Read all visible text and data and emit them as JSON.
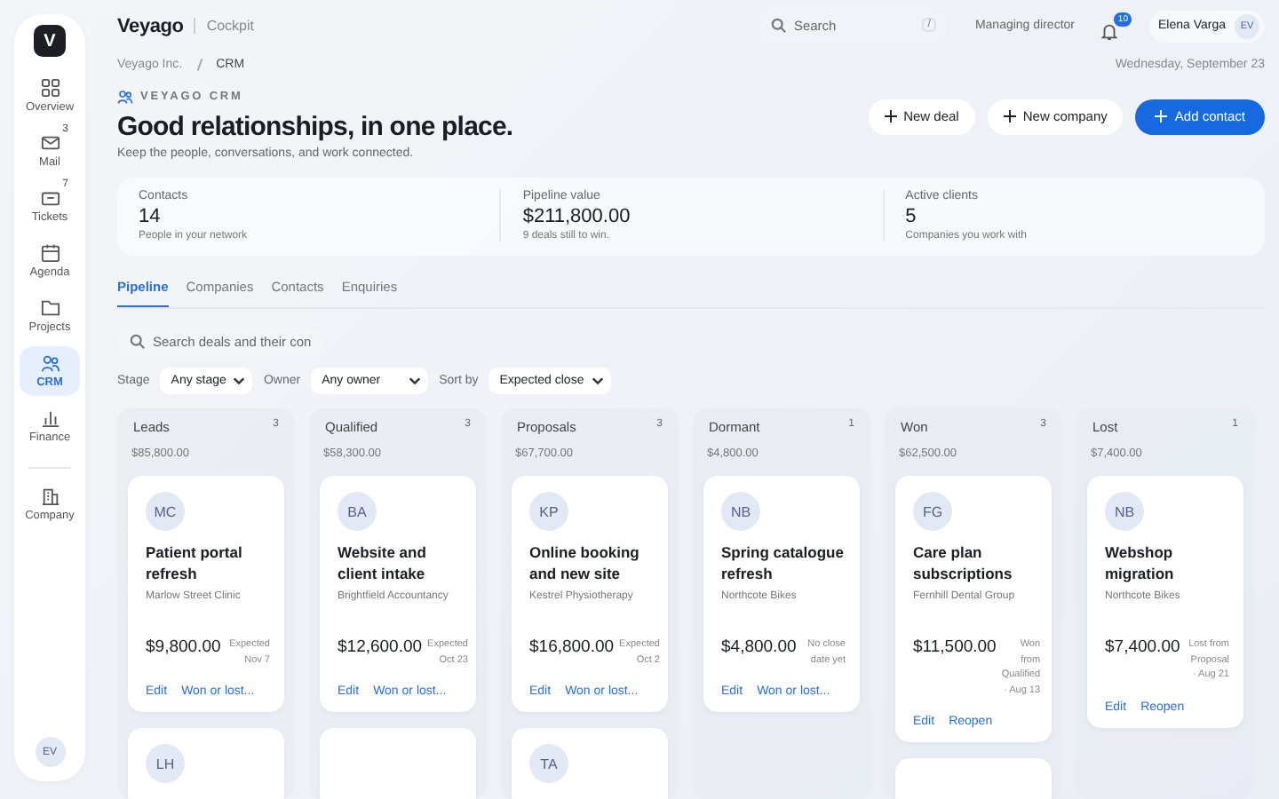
{
  "sidebar": {
    "logo": "V",
    "items": [
      {
        "label": "Overview",
        "selected": false
      },
      {
        "label": "Mail",
        "badge": "3",
        "selected": false
      },
      {
        "label": "Tickets",
        "badge": "7",
        "selected": false
      },
      {
        "label": "Agenda",
        "selected": false
      },
      {
        "label": "Projects",
        "selected": false
      },
      {
        "label": "CRM",
        "selected": true
      },
      {
        "label": "Finance",
        "selected": false
      },
      {
        "label": "Company",
        "selected": false,
        "divider_before": true
      }
    ],
    "user_initials": "EV"
  },
  "topbar": {
    "brand": "Veyago",
    "section": "Cockpit",
    "search_placeholder": "Search",
    "search_shortcut": "/",
    "role": "Managing director",
    "notifications": "10",
    "user_name": "Elena Varga",
    "user_initials": "EV"
  },
  "breadcrumb": [
    "Veyago Inc.",
    "CRM"
  ],
  "date": "Wednesday, September 23",
  "header": {
    "eyebrow": "VEYAGO CRM",
    "title": "Good relationships, in one place.",
    "subtitle": "Keep the people, conversations, and work connected.",
    "buttons": [
      {
        "label": "New deal",
        "kind": "secondary"
      },
      {
        "label": "New company",
        "kind": "secondary"
      },
      {
        "label": "Add contact",
        "kind": "primary"
      }
    ]
  },
  "stats": [
    {
      "label": "Contacts",
      "value": "14",
      "note": "People in your network"
    },
    {
      "label": "Pipeline value",
      "value": "$211,800.00",
      "note": "9 deals still to win."
    },
    {
      "label": "Active clients",
      "value": "5",
      "note": "Companies you work with"
    }
  ],
  "tabs": [
    {
      "label": "Pipeline",
      "selected": true
    },
    {
      "label": "Companies",
      "selected": false
    },
    {
      "label": "Contacts",
      "selected": false
    },
    {
      "label": "Enquiries",
      "selected": false
    }
  ],
  "filters": {
    "search_placeholder": "Search deals and their con",
    "selects": [
      {
        "label": "Stage",
        "value": "Any stage"
      },
      {
        "label": "Owner",
        "value": "Any owner"
      },
      {
        "label": "Sort by",
        "value": "Expected close"
      }
    ]
  },
  "columns": [
    {
      "name": "Leads",
      "count": "3",
      "total": "$85,800.00",
      "cards": [
        {
          "kind": "deal",
          "initials": "MC",
          "title": "Patient portal refresh",
          "company": "Marlow Street Clinic",
          "amount": "$9,800.00",
          "note": "Expected Nov 7",
          "actions": [
            "Edit",
            "Won or lost..."
          ]
        },
        {
          "kind": "peek",
          "initials": "LH"
        }
      ]
    },
    {
      "name": "Qualified",
      "count": "3",
      "total": "$58,300.00",
      "cards": [
        {
          "kind": "deal",
          "initials": "BA",
          "title": "Website and client intake",
          "company": "Brightfield Accountancy",
          "amount": "$12,600.00",
          "note": "Expected Oct 23",
          "actions": [
            "Edit",
            "Won or lost..."
          ]
        },
        {
          "kind": "peek"
        }
      ]
    },
    {
      "name": "Proposals",
      "count": "3",
      "total": "$67,700.00",
      "cards": [
        {
          "kind": "deal",
          "initials": "KP",
          "title": "Online booking and new site",
          "company": "Kestrel Physiotherapy",
          "amount": "$16,800.00",
          "note": "Expected Oct 2",
          "actions": [
            "Edit",
            "Won or lost..."
          ]
        },
        {
          "kind": "peek",
          "initials": "TA"
        }
      ]
    },
    {
      "name": "Dormant",
      "count": "1",
      "total": "$4,800.00",
      "cards": [
        {
          "kind": "deal",
          "initials": "NB",
          "title": "Spring catalogue refresh",
          "company": "Northcote Bikes",
          "amount": "$4,800.00",
          "note": "No close date yet",
          "actions": [
            "Edit",
            "Won or lost..."
          ]
        }
      ]
    },
    {
      "name": "Won",
      "count": "3",
      "total": "$62,500.00",
      "cards": [
        {
          "kind": "deal",
          "initials": "FG",
          "title": "Care plan subscriptions",
          "company": "Fernhill Dental Group",
          "amount": "$11,500.00",
          "note": "Won from Qualified · Aug 13",
          "actions": [
            "Edit",
            "Reopen"
          ]
        },
        {
          "kind": "peek"
        }
      ]
    },
    {
      "name": "Lost",
      "count": "1",
      "total": "$7,400.00",
      "cards": [
        {
          "kind": "deal",
          "initials": "NB",
          "title": "Webshop migration",
          "company": "Northcote Bikes",
          "amount": "$7,400.00",
          "note": "Lost from Proposal · Aug 21",
          "actions": [
            "Edit",
            "Reopen"
          ]
        }
      ]
    }
  ]
}
